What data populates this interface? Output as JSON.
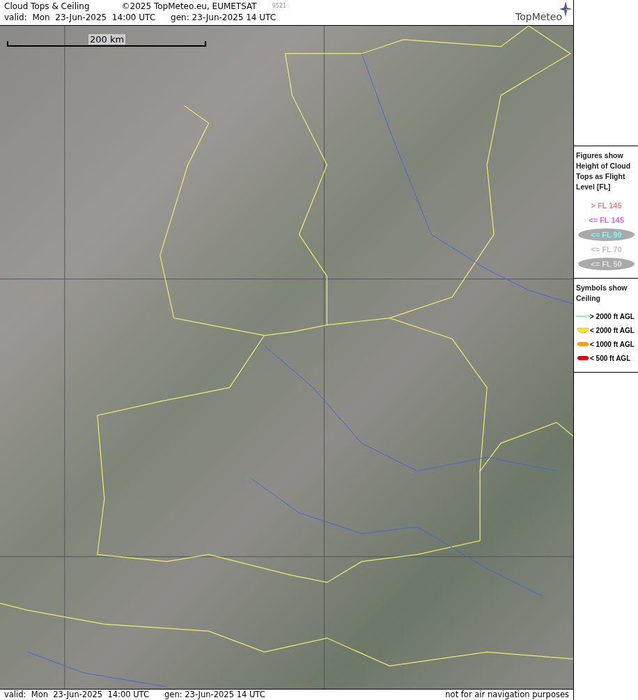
{
  "header": {
    "title": "Cloud Tops & Ceiling",
    "copyright": "©2025 TopMeteo.eu, EUMETSAT",
    "code": "9521",
    "valid": "valid:  Mon  23-Jun-2025  14:00 UTC",
    "generated": "gen: 23-Jun-2025 14 UTC",
    "logo": "TopMeteo"
  },
  "map": {
    "scale_label": "200 km"
  },
  "legend_cloud_tops": {
    "title": "Figures show Height of Cloud Tops as Flight Level  [FL]",
    "items": [
      {
        "label": "> FL 145",
        "color": "#ff8080",
        "highlighted": false
      },
      {
        "label": "<= FL 145",
        "color": "#cc66ff",
        "highlighted": false
      },
      {
        "label": "<= FL 90",
        "color": "#66ffff",
        "highlighted": true
      },
      {
        "label": "<= FL 70",
        "color": "#c0c0c0",
        "highlighted": false
      },
      {
        "label": "<= FL 50",
        "color": "#e0e0e0",
        "highlighted": true
      }
    ]
  },
  "legend_ceiling": {
    "title": "Symbols show Ceiling",
    "items": [
      {
        "kind": "line",
        "label": "> 2000 ft AGL",
        "color": "#99ee99"
      },
      {
        "kind": "halfcircle",
        "label": "< 2000 ft AGL",
        "color": "#ffee00"
      },
      {
        "kind": "pill",
        "label": "< 1000 ft AGL",
        "color": "#ffa000"
      },
      {
        "kind": "pill",
        "label": "< 500 ft AGL",
        "color": "#ee0000"
      }
    ]
  },
  "footer": {
    "valid": "valid:  Mon  23-Jun-2025  14:00 UTC",
    "generated": "gen: 23-Jun-2025 14 UTC",
    "disclaimer": "not for air navigation purposes"
  }
}
